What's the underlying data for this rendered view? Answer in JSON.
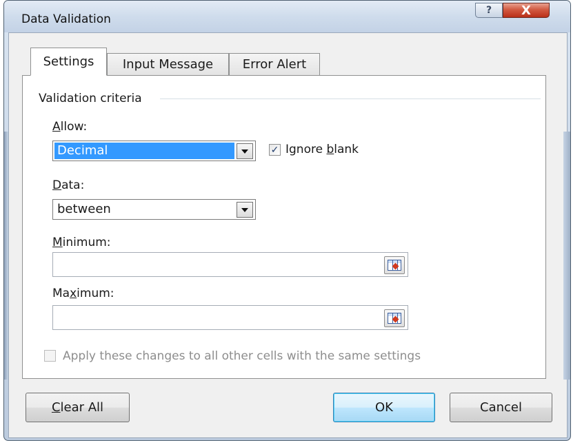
{
  "window": {
    "title": "Data Validation",
    "help_label": "?",
    "close_label": "X"
  },
  "tabs": [
    {
      "label": "Settings",
      "active": true
    },
    {
      "label": "Input Message",
      "active": false
    },
    {
      "label": "Error Alert",
      "active": false
    }
  ],
  "settings": {
    "group_label": "Validation criteria",
    "allow": {
      "label_first": "A",
      "label_rest": "llow:",
      "value": "Decimal"
    },
    "ignore_blank": {
      "label_pre": "Ignore ",
      "label_u": "b",
      "label_post": "lank",
      "checked": true,
      "mark": "✓"
    },
    "data": {
      "label_first": "D",
      "label_rest": "ata:",
      "value": "between"
    },
    "minimum": {
      "label_first": "M",
      "label_rest": "inimum:",
      "value": ""
    },
    "maximum": {
      "label_pre": "Ma",
      "label_u": "x",
      "label_post": "imum:",
      "value": ""
    },
    "apply_all": {
      "label": "Apply these changes to all other cells with the same settings",
      "checked": false,
      "disabled": true
    }
  },
  "buttons": {
    "clear_all_u": "C",
    "clear_all_rest": "lear All",
    "ok": "OK",
    "cancel": "Cancel"
  },
  "colors": {
    "selection": "#3399ff",
    "close": "#c9432b",
    "default_button": "#bee6fd"
  },
  "icons": {
    "dropdown": "chevron-down-icon",
    "range_selector": "collapse-dialog-icon",
    "check": "checkmark-icon"
  }
}
